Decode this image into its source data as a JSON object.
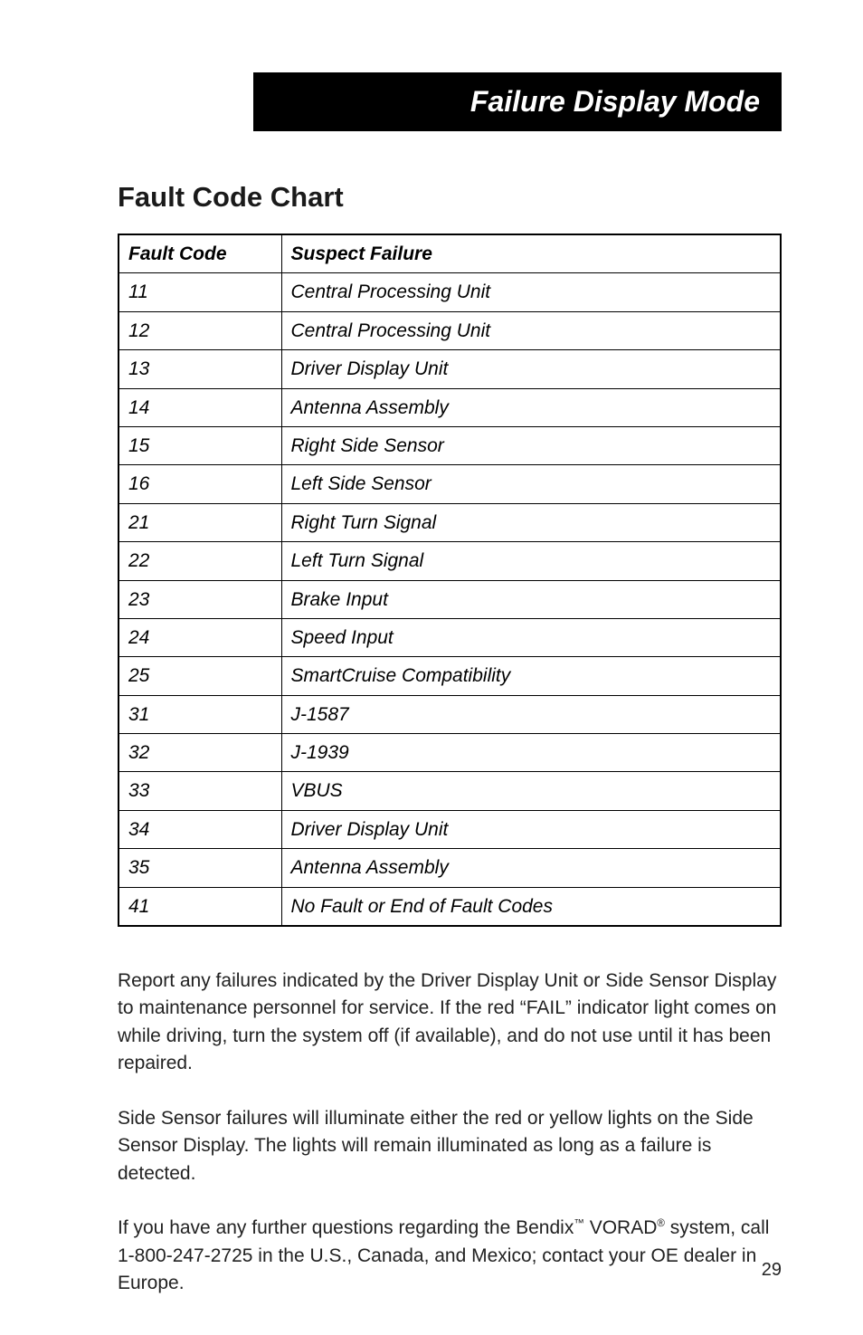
{
  "header": {
    "title": "Failure Display Mode"
  },
  "section": {
    "title": "Fault Code Chart"
  },
  "chart_data": {
    "type": "table",
    "title": "Fault Code Chart",
    "columns": [
      "Fault Code",
      "Suspect Failure"
    ],
    "rows": [
      {
        "code": "11",
        "failure": "Central Processing Unit"
      },
      {
        "code": "12",
        "failure": "Central Processing Unit"
      },
      {
        "code": "13",
        "failure": "Driver Display Unit"
      },
      {
        "code": "14",
        "failure": "Antenna Assembly"
      },
      {
        "code": "15",
        "failure": "Right Side Sensor"
      },
      {
        "code": "16",
        "failure": "Left Side Sensor"
      },
      {
        "code": "21",
        "failure": "Right Turn Signal"
      },
      {
        "code": "22",
        "failure": "Left Turn Signal"
      },
      {
        "code": "23",
        "failure": "Brake Input"
      },
      {
        "code": "24",
        "failure": "Speed Input"
      },
      {
        "code": "25",
        "failure": "SmartCruise Compatibility"
      },
      {
        "code": "31",
        "failure": "J-1587"
      },
      {
        "code": "32",
        "failure": "J-1939"
      },
      {
        "code": "33",
        "failure": "VBUS"
      },
      {
        "code": "34",
        "failure": "Driver Display Unit"
      },
      {
        "code": "35",
        "failure": "Antenna Assembly"
      },
      {
        "code": "41",
        "failure": "No Fault or End of Fault Codes"
      }
    ]
  },
  "paragraphs": {
    "p1": "Report any failures indicated by the Driver Display Unit or Side Sensor Display to maintenance personnel for service. If the red “FAIL” indicator light comes on while driving, turn the system off (if available), and do not use until it has been repaired.",
    "p2": "Side Sensor failures will illuminate either the red or yellow lights on the Side Sensor Display. The lights will remain illuminated as long as a failure is detected.",
    "p3_part1": "If you have any further questions regarding the Bendix",
    "p3_tm": "™",
    "p3_part2": " VORAD",
    "p3_reg": "®",
    "p3_part3": " system, call 1-800-247-2725 in the U.S., Canada, and Mexico; contact your OE dealer in Europe."
  },
  "page_number": "29"
}
